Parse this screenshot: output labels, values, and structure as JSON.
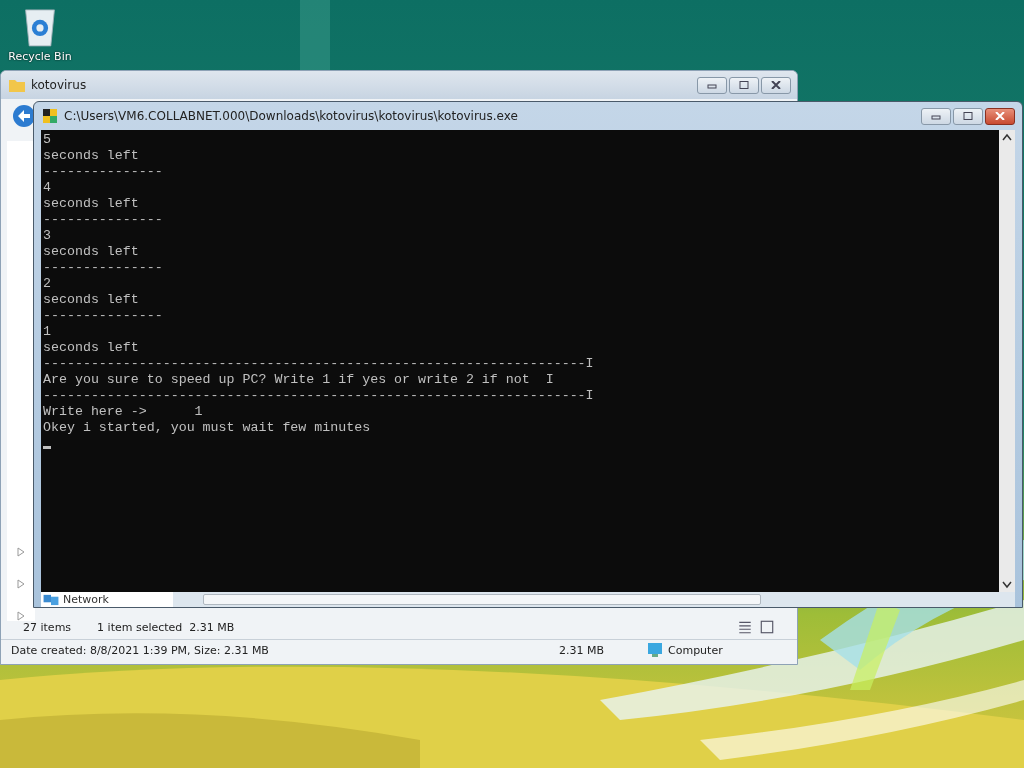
{
  "desktop": {
    "icons": [
      {
        "label": "Recycle Bin"
      }
    ]
  },
  "explorer": {
    "title": "kotovirus",
    "nav_items": [
      {
        "label": "Network"
      }
    ],
    "status": {
      "count": "27 items",
      "selection": "1 item selected  2.31 MB"
    },
    "details": {
      "info": "Date created: 8/8/2021 1:39 PM, Size: 2.31 MB",
      "size": "2.31 MB",
      "zone": "Computer"
    }
  },
  "console": {
    "title": "C:\\Users\\VM6.COLLABNET.000\\Downloads\\kotovirus\\kotovirus\\kotovirus.exe",
    "lines": [
      "5",
      "seconds left",
      "---------------",
      "4",
      "seconds left",
      "---------------",
      "3",
      "seconds left",
      "---------------",
      "2",
      "seconds left",
      "---------------",
      "1",
      "seconds left",
      "--------------------------------------------------------------------I",
      "Are you sure to speed up PC? Write 1 if yes or write 2 if not  I",
      "--------------------------------------------------------------------I",
      "Write here ->      1",
      "Okey i started, you must wait few minutes"
    ]
  }
}
